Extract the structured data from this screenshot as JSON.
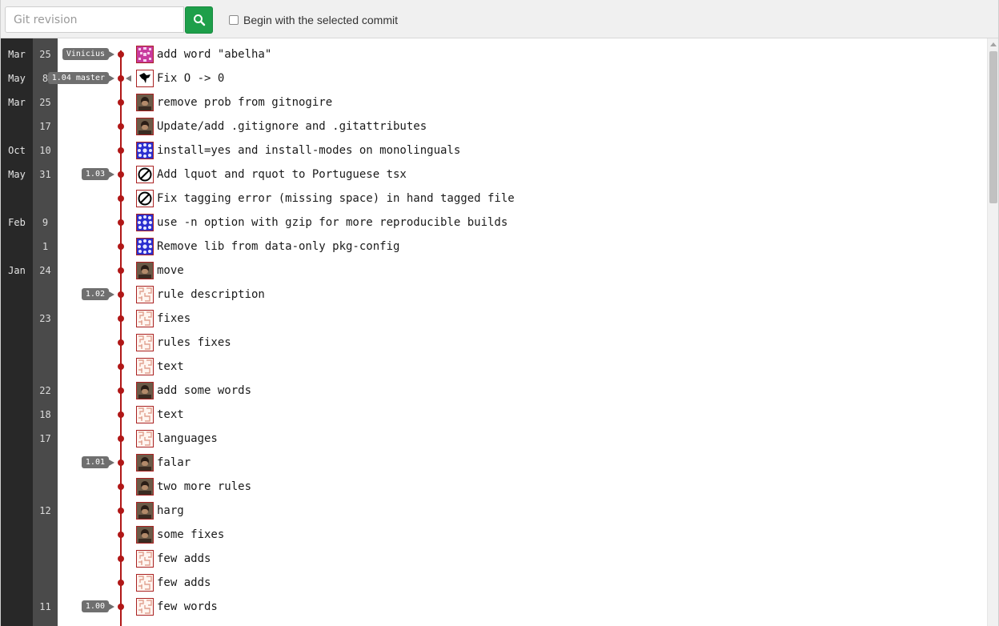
{
  "toolbar": {
    "revision_placeholder": "Git revision",
    "search_icon": "magnifier-icon",
    "begin_label": "Begin with the selected commit",
    "search_button_color": "#1e9f4a"
  },
  "colors": {
    "graph": "#b01717",
    "ref_badge": "#6f6f6f",
    "month_column": "#282828",
    "day_column": "#4a4a4a"
  },
  "commits": [
    {
      "month": "Mar",
      "day": "25",
      "refs": "Vinicius",
      "head": false,
      "avatar": "pink-identicon",
      "message": "add word \"abelha\""
    },
    {
      "month": "May",
      "day": "8",
      "refs": "1.04 master",
      "head": true,
      "avatar": "dog-silhouette",
      "message": "Fix O -> 0"
    },
    {
      "month": "Mar",
      "day": "25",
      "refs": "",
      "head": false,
      "avatar": "photo-avatar",
      "message": "remove prob from gitnogire"
    },
    {
      "month": "",
      "day": "17",
      "refs": "",
      "head": false,
      "avatar": "photo-avatar",
      "message": "Update/add .gitignore and .gitattributes"
    },
    {
      "month": "Oct",
      "day": "10",
      "refs": "",
      "head": false,
      "avatar": "blue-identicon",
      "message": "install=yes and install-modes on monolinguals"
    },
    {
      "month": "May",
      "day": "31",
      "refs": "1.03",
      "head": false,
      "avatar": "no-symbol-avatar",
      "message": "Add lquot and rquot to Portuguese tsx"
    },
    {
      "month": "",
      "day": "",
      "refs": "",
      "head": false,
      "avatar": "no-symbol-avatar",
      "message": "Fix tagging error (missing space) in hand tagged file"
    },
    {
      "month": "Feb",
      "day": "9",
      "refs": "",
      "head": false,
      "avatar": "blue-identicon",
      "message": "use -n option with gzip for more reproducible builds"
    },
    {
      "month": "",
      "day": "1",
      "refs": "",
      "head": false,
      "avatar": "blue-identicon",
      "message": "Remove lib from data-only pkg-config"
    },
    {
      "month": "Jan",
      "day": "24",
      "refs": "",
      "head": false,
      "avatar": "photo-avatar",
      "message": "move"
    },
    {
      "month": "",
      "day": "",
      "refs": "1.02",
      "head": false,
      "avatar": "maze-identicon",
      "message": "rule description"
    },
    {
      "month": "",
      "day": "23",
      "refs": "",
      "head": false,
      "avatar": "maze-identicon",
      "message": "fixes"
    },
    {
      "month": "",
      "day": "",
      "refs": "",
      "head": false,
      "avatar": "maze-identicon",
      "message": "rules fixes"
    },
    {
      "month": "",
      "day": "",
      "refs": "",
      "head": false,
      "avatar": "maze-identicon",
      "message": "text"
    },
    {
      "month": "",
      "day": "22",
      "refs": "",
      "head": false,
      "avatar": "photo-avatar",
      "message": "add some words"
    },
    {
      "month": "",
      "day": "18",
      "refs": "",
      "head": false,
      "avatar": "maze-identicon",
      "message": "text"
    },
    {
      "month": "",
      "day": "17",
      "refs": "",
      "head": false,
      "avatar": "maze-identicon",
      "message": "languages"
    },
    {
      "month": "",
      "day": "",
      "refs": "1.01",
      "head": false,
      "avatar": "photo-avatar",
      "message": "falar"
    },
    {
      "month": "",
      "day": "",
      "refs": "",
      "head": false,
      "avatar": "photo-avatar",
      "message": "two more rules"
    },
    {
      "month": "",
      "day": "12",
      "refs": "",
      "head": false,
      "avatar": "photo-avatar",
      "message": "harg"
    },
    {
      "month": "",
      "day": "",
      "refs": "",
      "head": false,
      "avatar": "photo-avatar",
      "message": "some fixes"
    },
    {
      "month": "",
      "day": "",
      "refs": "",
      "head": false,
      "avatar": "maze-identicon",
      "message": "few adds"
    },
    {
      "month": "",
      "day": "",
      "refs": "",
      "head": false,
      "avatar": "maze-identicon",
      "message": "few adds"
    },
    {
      "month": "",
      "day": "11",
      "refs": "1.00",
      "head": false,
      "avatar": "maze-identicon",
      "message": "few words"
    }
  ]
}
